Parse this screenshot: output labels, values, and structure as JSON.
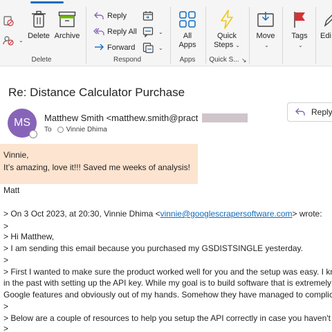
{
  "ribbon": {
    "delete_group": {
      "label": "Delete",
      "delete_label": "Delete",
      "archive_label": "Archive"
    },
    "respond_group": {
      "label": "Respond",
      "reply_label": "Reply",
      "reply_all_label": "Reply All",
      "forward_label": "Forward"
    },
    "apps_group": {
      "label": "Apps",
      "all_apps_label_1": "All",
      "all_apps_label_2": "Apps"
    },
    "quicksteps_group": {
      "label": "Quick S...",
      "quick_steps_label_1": "Quick",
      "quick_steps_label_2": "Steps"
    },
    "move_label": "Move",
    "tags_label": "Tags",
    "editing_label": "Edi"
  },
  "message": {
    "subject": "Re: Distance Calculator Purchase",
    "avatar_initials": "MS",
    "sender": "Matthew Smith <matthew.smith@pract",
    "to_label": "To",
    "recipient": "Vinnie Dhima",
    "reply_button": "Reply"
  },
  "body": {
    "highlight_lines": [
      "Vinnie,",
      "It’s amazing, love it!!! Saved me weeks of analysis!"
    ],
    "signoff": "Matt",
    "quote_intro_prefix": "> On 3 Oct 2023, at 20:30, Vinnie Dhima <",
    "quote_email": "vinnie@googlescrapersoftware.com",
    "quote_intro_suffix": "> wrote:",
    "quote_lines": [
      ">",
      "> Hi Matthew,",
      "> I am sending this email because you purchased my GSDISTSINGLE yesterday.",
      ">",
      "> First I wanted to make sure the product worked well for you and the setup was easy. I kn",
      "in the past with setting up the API key. While my goal is to build software that is extremely",
      "Google features and obviously out of my hands. Somehow they have managed to complica",
      ">",
      "> Below are a couple of resources to help you setup the API correctly in case you haven't d",
      ">"
    ]
  },
  "colors": {
    "accent": "#0f6cbd",
    "avatar": "#8764b8",
    "highlight": "#fce4d0",
    "quick_steps_icon": "#f2c811",
    "tags_flag": "#d13438"
  },
  "icons": {
    "ignore": "ignore-icon",
    "junk": "junk-icon",
    "delete": "trash-icon",
    "archive": "archive-icon",
    "reply": "reply-arrow-icon",
    "reply_all": "reply-all-icon",
    "forward": "forward-arrow-icon",
    "meeting": "meeting-icon",
    "im": "im-icon",
    "more_respond": "more-respond-icon",
    "all_apps": "apps-grid-icon",
    "quick_steps": "lightning-icon",
    "move": "move-folder-icon",
    "tags": "flag-icon"
  }
}
